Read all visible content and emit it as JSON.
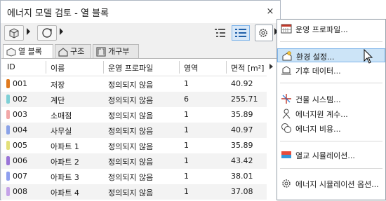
{
  "window": {
    "title": "에너지 모델 검토 - 열 블록",
    "close_glyph": "×"
  },
  "toolbar": {
    "views": [
      "list-view-icon",
      "details-view-icon"
    ]
  },
  "tabs": [
    {
      "label": "열 블록",
      "active": true
    },
    {
      "label": "구조",
      "active": false
    },
    {
      "label": "개구부",
      "active": false
    }
  ],
  "table": {
    "headers": {
      "id": "ID",
      "name": "이름",
      "profile": "운영 프로파일",
      "zone": "영역",
      "area": "면적 [m²]"
    },
    "rows": [
      {
        "id": "001",
        "name": "저장",
        "profile": "정의되지 않음",
        "zone": "1",
        "area": "40.92",
        "color": "#e07a1f"
      },
      {
        "id": "002",
        "name": "계단",
        "profile": "정의되지 않음",
        "zone": "6",
        "area": "255.71",
        "color": "#7ed0d6"
      },
      {
        "id": "003",
        "name": "소매점",
        "profile": "정의되지 않음",
        "zone": "1",
        "area": "35.89",
        "color": "#f2a8a8"
      },
      {
        "id": "004",
        "name": "사무실",
        "profile": "정의되지 않음",
        "zone": "1",
        "area": "40.97",
        "color": "#8aa2e8"
      },
      {
        "id": "005",
        "name": "아파트 1",
        "profile": "정의되지 않음",
        "zone": "1",
        "area": "35.89",
        "color": "#e3e07a"
      },
      {
        "id": "006",
        "name": "아파트 2",
        "profile": "정의되지 않음",
        "zone": "1",
        "area": "43.42",
        "color": "#9a74d8"
      },
      {
        "id": "007",
        "name": "아파트 3",
        "profile": "정의되지 않음",
        "zone": "1",
        "area": "38.01",
        "color": "#8fa0f0"
      },
      {
        "id": "008",
        "name": "아파트 4",
        "profile": "정의되지 않음",
        "zone": "1",
        "area": "37.08",
        "color": "#c5a3e8"
      }
    ]
  },
  "menu": {
    "items": [
      {
        "label": "운영 프로파일...",
        "icon": "operation-profile-icon"
      },
      {
        "label": "환경 설정...",
        "icon": "environment-settings-icon",
        "highlighted": true
      },
      {
        "label": "기후 데이터...",
        "icon": "climate-data-icon"
      },
      {
        "label": "건물 시스템...",
        "icon": "building-systems-icon"
      },
      {
        "label": "에너지원 계수...",
        "icon": "energy-source-factors-icon"
      },
      {
        "label": "에너지 비용...",
        "icon": "energy-cost-icon"
      },
      {
        "label": "열교 시뮬레이션...",
        "icon": "thermal-bridge-icon"
      },
      {
        "label": "에너지 시뮬레이션 옵션...",
        "icon": "simulation-options-icon"
      }
    ]
  },
  "colors": {
    "accent": "#1f6fd1",
    "highlight": "#cce4f7"
  }
}
